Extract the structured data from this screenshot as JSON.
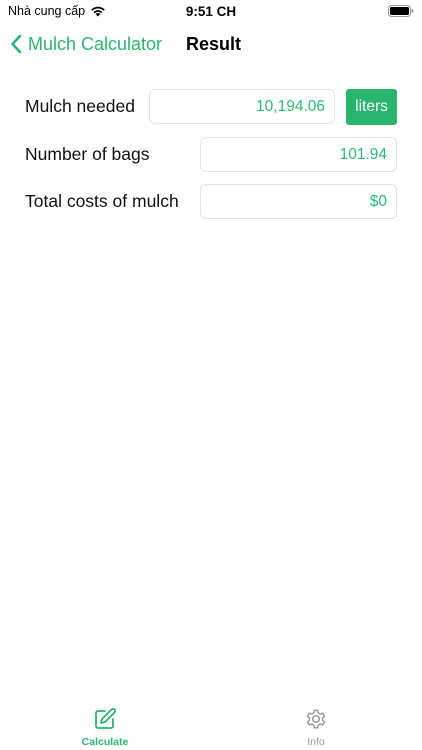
{
  "status_bar": {
    "carrier": "Nhà cung cấp",
    "time": "9:51 CH",
    "icons": [
      "wifi-icon",
      "battery-icon"
    ]
  },
  "nav": {
    "back_label": "Mulch Calculator",
    "title": "Result",
    "icon": "chevron-left-icon"
  },
  "results": {
    "mulch_needed": {
      "label": "Mulch needed",
      "value": "10,194.06",
      "unit": "liters"
    },
    "number_of_bags": {
      "label": "Number of bags",
      "value": "101.94"
    },
    "total_cost": {
      "label": "Total costs of mulch",
      "value": "$0"
    }
  },
  "tabs": [
    {
      "label": "Calculate",
      "icon": "pencil-square-icon",
      "active": true
    },
    {
      "label": "Info",
      "icon": "gear-icon",
      "active": false
    }
  ],
  "colors": {
    "accent": "#29b56e",
    "value_text": "#2db877",
    "inactive_tab": "#9a9a9a",
    "field_border": "#e3e3e3"
  }
}
